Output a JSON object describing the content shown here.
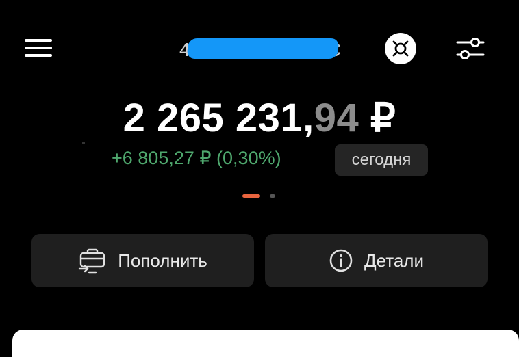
{
  "header": {
    "menu_icon": "hamburger-icon",
    "account_prefix": "4",
    "account_suffix": "С",
    "account_redaction_color": "#1497f8",
    "currency_icon": "generic-currency-icon",
    "settings_icon": "sliders-icon"
  },
  "portfolio": {
    "balance_main": "2 265 231,",
    "balance_fraction": "94",
    "balance_currency": " ₽",
    "change": "+6 805,27 ₽ (0,30%)",
    "change_color": "#4fa86e",
    "period": "сегодня"
  },
  "pager": {
    "pages": 2,
    "active": 1,
    "active_color": "#e8643e"
  },
  "actions": {
    "top_up": {
      "label": "Пополнить",
      "icon": "briefcase-transfer-icon"
    },
    "details": {
      "label": "Детали",
      "icon": "info-circle-icon"
    }
  }
}
